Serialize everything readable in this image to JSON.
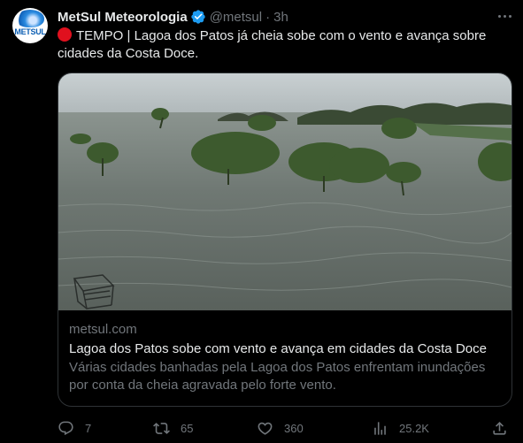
{
  "tweet": {
    "author_name": "MetSul Meteorologia",
    "handle": "@metsul",
    "separator": "·",
    "time": "3h",
    "avatar_text": "METSUL",
    "text": "TEMPO | Lagoa dos Patos já cheia sobe com o vento e avança sobre cidades da Costa Doce.",
    "text_emoji": "red-circle"
  },
  "card": {
    "domain": "metsul.com",
    "title": "Lagoa dos Patos sobe com vento e avança em cidades da Costa Doce",
    "description": "Várias cidades banhadas pela Lagoa dos Patos enfrentam inundações por conta da cheia agravada pelo forte vento."
  },
  "actions": {
    "replies": "7",
    "reposts": "65",
    "likes": "360",
    "views": "25.2K"
  },
  "colors": {
    "background": "#000000",
    "text_primary": "#e7e9ea",
    "text_secondary": "#71767b",
    "verified": "#1d9bf0",
    "border": "#2f3336"
  },
  "icons": [
    "verified-badge-icon",
    "more-icon",
    "reply-icon",
    "repost-icon",
    "like-icon",
    "views-icon",
    "share-icon"
  ]
}
